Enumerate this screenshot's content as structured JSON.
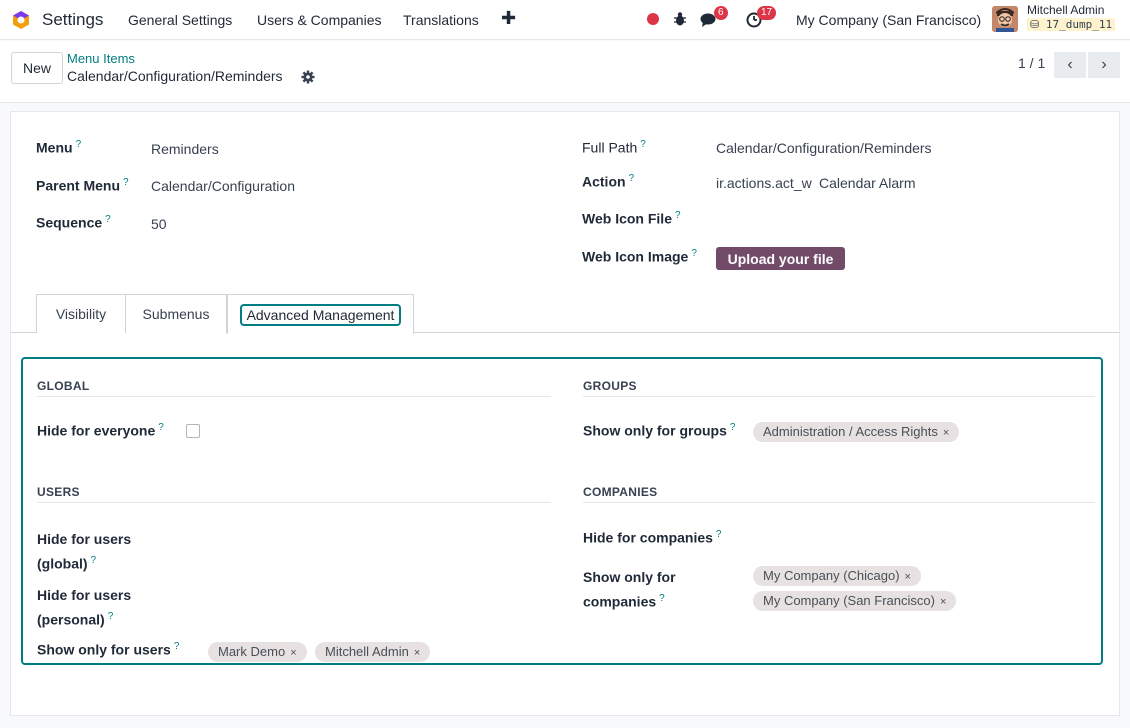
{
  "navbar": {
    "app_name": "Settings",
    "menus": [
      "General Settings",
      "Users & Companies",
      "Translations"
    ],
    "plus_label": "✚",
    "messages_count": "6",
    "activities_count": "17",
    "company": "My Company (San Francisco)",
    "user_name": "Mitchell Admin",
    "db_name": "17_dump_11"
  },
  "control": {
    "new_label": "New",
    "breadcrumb_parent": "Menu Items",
    "breadcrumb_current": "Calendar/Configuration/Reminders",
    "pager": "1 / 1"
  },
  "form": {
    "menu_label": "Menu",
    "menu_value": "Reminders",
    "parent_label": "Parent Menu",
    "parent_value": "Calendar/Configuration",
    "sequence_label": "Sequence",
    "sequence_value": "50",
    "fullpath_label": "Full Path",
    "fullpath_value": "Calendar/Configuration/Reminders",
    "action_label": "Action",
    "action_value": "ir.actions.act_w",
    "action_record": "Calendar Alarm",
    "webicon_label": "Web Icon File",
    "webimage_label": "Web Icon Image",
    "upload_label": "Upload your file",
    "help_mark": "?"
  },
  "tabs": [
    "Visibility",
    "Submenus",
    "Advanced Management"
  ],
  "advanced": {
    "global_title": "GLOBAL",
    "hide_everyone_label": "Hide for everyone",
    "users_title": "USERS",
    "hide_users_global_l1": "Hide for users",
    "hide_users_global_l2": "(global)",
    "hide_users_personal_l1": "Hide for users",
    "hide_users_personal_l2": "(personal)",
    "show_users_label": "Show only for users",
    "user_tags": [
      "Mark Demo",
      "Mitchell Admin"
    ],
    "groups_title": "GROUPS",
    "show_groups_label": "Show only for groups",
    "group_tags": [
      "Administration / Access Rights"
    ],
    "companies_title": "COMPANIES",
    "hide_companies_label": "Hide for companies",
    "show_companies_l1": "Show only for",
    "show_companies_l2": "companies",
    "company_tags": [
      "My Company (Chicago)",
      "My Company (San Francisco)"
    ],
    "remove_mark": "×"
  }
}
